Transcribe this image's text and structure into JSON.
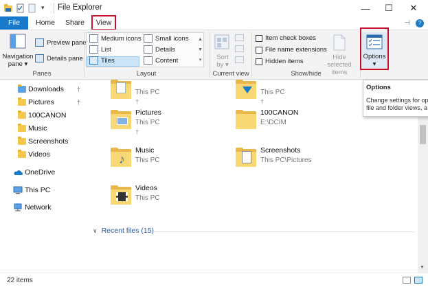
{
  "window": {
    "title": "File Explorer",
    "minimize_glyph": "—",
    "maximize_glyph": "☐",
    "close_glyph": "✕"
  },
  "tabs": {
    "file": "File",
    "home": "Home",
    "share": "Share",
    "view": "View",
    "pin_glyph": "⊣",
    "help_glyph": "?"
  },
  "ribbon": {
    "panes": {
      "navigation_pane_line1": "Navigation",
      "navigation_pane_line2": "pane ▾",
      "preview_pane": "Preview pane",
      "details_pane": "Details pane",
      "group_label": "Panes"
    },
    "layout": {
      "medium_icons": "Medium icons",
      "small_icons": "Small icons",
      "list": "List",
      "details": "Details",
      "tiles": "Tiles",
      "content": "Content",
      "group_label": "Layout"
    },
    "current_view": {
      "sort_by_line1": "Sort",
      "sort_by_line2": "by ▾",
      "group_label": "Current view"
    },
    "show_hide": {
      "item_check_boxes": "Item check boxes",
      "file_name_extensions": "File name extensions",
      "hidden_items": "Hidden items",
      "hide_selected_line1": "Hide selected",
      "hide_selected_line2": "items",
      "group_label": "Show/hide"
    },
    "options": {
      "label": "Options",
      "arrow": "▾"
    }
  },
  "nav_pane": {
    "items": [
      {
        "label": "Downloads",
        "pinned": true
      },
      {
        "label": "Pictures",
        "pinned": true
      },
      {
        "label": "100CANON",
        "pinned": false
      },
      {
        "label": "Music",
        "pinned": false
      },
      {
        "label": "Screenshots",
        "pinned": false
      },
      {
        "label": "Videos",
        "pinned": false
      }
    ],
    "onedrive": "OneDrive",
    "this_pc": "This PC",
    "network": "Network",
    "pin_glyph": "†"
  },
  "content": {
    "tiles": [
      {
        "name": "",
        "sub": "This PC",
        "pinned": true,
        "icon": "documents-folder-icon"
      },
      {
        "name": "",
        "sub": "This PC",
        "pinned": true,
        "icon": "downloads-folder-icon"
      },
      {
        "name": "Pictures",
        "sub": "This PC",
        "pinned": true,
        "icon": "pictures-folder-icon"
      },
      {
        "name": "100CANON",
        "sub": "E:\\DCIM",
        "pinned": false,
        "icon": "folder-icon"
      },
      {
        "name": "Music",
        "sub": "This PC",
        "pinned": false,
        "icon": "music-folder-icon"
      },
      {
        "name": "Screenshots",
        "sub": "This PC\\Pictures",
        "pinned": false,
        "icon": "screenshots-folder-icon"
      },
      {
        "name": "Videos",
        "sub": "This PC",
        "pinned": false,
        "icon": "videos-folder-icon"
      }
    ],
    "recent_files": "Recent files (15)",
    "pin_glyph": "†",
    "chevron_glyph": "∨"
  },
  "tooltip": {
    "title": "Options",
    "body_line1": "Change settings for op",
    "body_line2": "file and folder views, a"
  },
  "status": {
    "items_count": "22 items"
  },
  "colors": {
    "accent": "#1979ca",
    "highlight_box": "#c8102e",
    "folder": "#f8d775"
  }
}
